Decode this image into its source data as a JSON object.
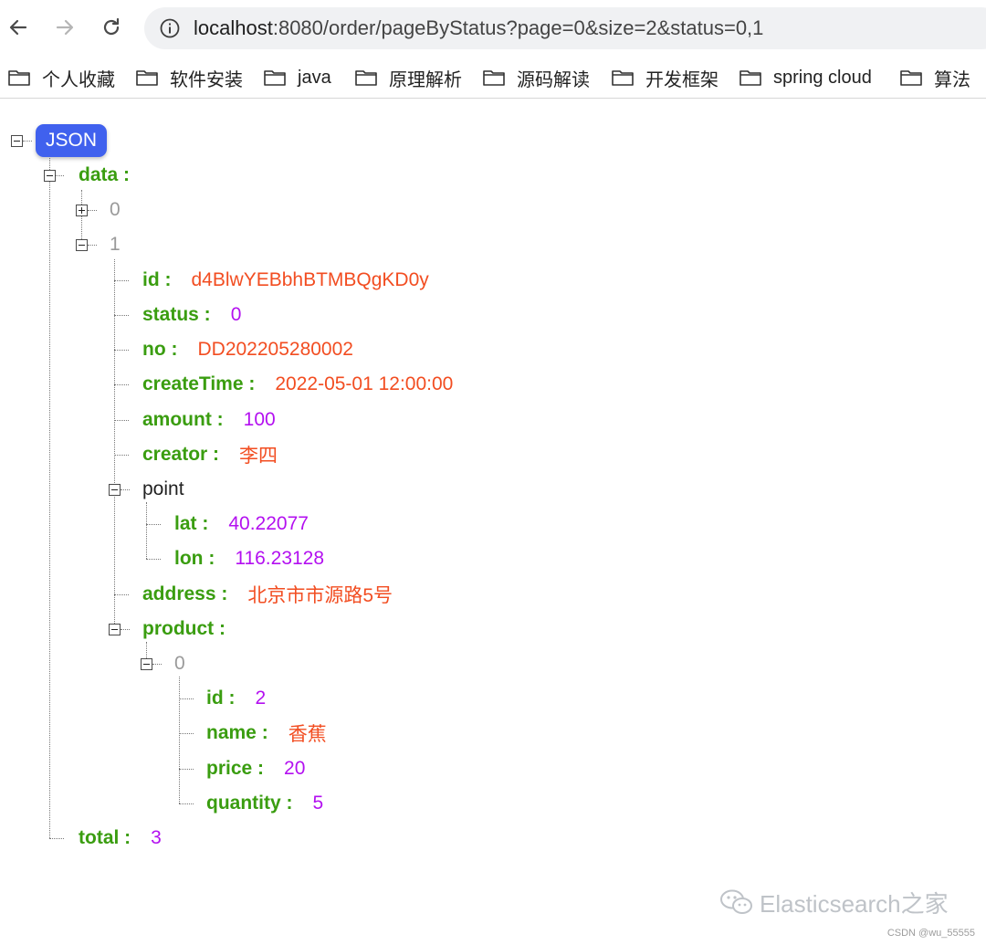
{
  "browser": {
    "url_host": "localhost",
    "url_rest": ":8080/order/pageByStatus?page=0&size=2&status=0,1",
    "bookmarks": [
      "个人收藏",
      "软件安装",
      "java",
      "原理解析",
      "源码解读",
      "开发框架",
      "spring cloud",
      "算法"
    ]
  },
  "json_view": {
    "root_label": "JSON",
    "data_key": "data :",
    "item0_index": "0",
    "item1_index": "1",
    "fields": {
      "id": {
        "key": "id :",
        "value": "d4BlwYEBbhBTMBQgKD0y"
      },
      "status": {
        "key": "status :",
        "value": "0"
      },
      "no": {
        "key": "no :",
        "value": "DD202205280002"
      },
      "createTime": {
        "key": "createTime :",
        "value": "2022-05-01 12:00:00"
      },
      "amount": {
        "key": "amount :",
        "value": "100"
      },
      "creator": {
        "key": "creator :",
        "value": "李四"
      }
    },
    "point": {
      "key": "point",
      "lat": {
        "key": "lat :",
        "value": "40.22077"
      },
      "lon": {
        "key": "lon :",
        "value": "116.23128"
      }
    },
    "address": {
      "key": "address :",
      "value": "北京市市源路5号"
    },
    "product": {
      "key": "product :",
      "item0_index": "0",
      "id": {
        "key": "id :",
        "value": "2"
      },
      "name": {
        "key": "name :",
        "value": "香蕉"
      },
      "price": {
        "key": "price :",
        "value": "20"
      },
      "quantity": {
        "key": "quantity :",
        "value": "5"
      }
    },
    "total": {
      "key": "total :",
      "value": "3"
    }
  },
  "watermark": "Elasticsearch之家",
  "credit": "CSDN @wu_55555",
  "colors": {
    "key_green": "#3a9d10",
    "string_red": "#f24d21",
    "number_purple": "#b310f0",
    "badge_blue": "#4061ee"
  }
}
